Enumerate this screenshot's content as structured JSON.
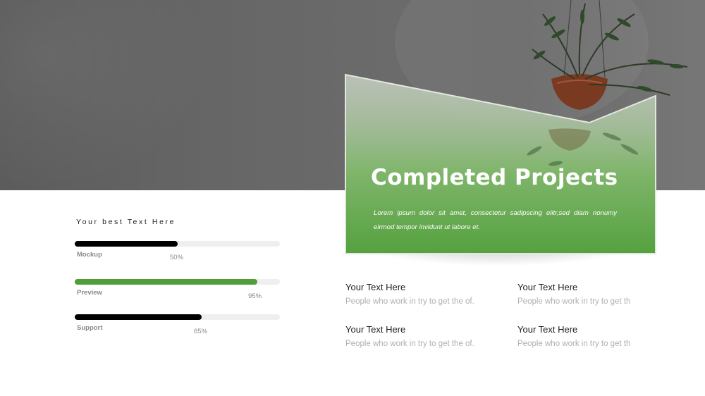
{
  "panel": {
    "title": "Completed Projects",
    "body": "Lorem ipsum dolor sit amet, consectetur sadipscing elitr,sed diam nonumy eirmod tempor invidunt ut labore et."
  },
  "progress": {
    "heading": "Your best Text Here",
    "bars": [
      {
        "label": "Mockup",
        "percent_text": "50%",
        "value": 0.5,
        "color": "#000000"
      },
      {
        "label": "Preview",
        "percent_text": "95%",
        "value": 0.89,
        "color": "#4f9e3a"
      },
      {
        "label": "Support",
        "percent_text": "65%",
        "value": 0.62,
        "color": "#000000"
      }
    ]
  },
  "items": [
    {
      "title": "Your Text Here",
      "body": "People who work in try to get the of."
    },
    {
      "title": "Your Text Here",
      "body": "People who work in try to get th"
    },
    {
      "title": "Your Text Here",
      "body": "People who work in try to get the of."
    },
    {
      "title": "Your Text Here",
      "body": "People who work in try to get th"
    }
  ],
  "colors": {
    "accent_green": "#4f9e3a",
    "track": "#efefef",
    "hero_gray": "#666666"
  },
  "icons": [
    "plant-decoration"
  ]
}
